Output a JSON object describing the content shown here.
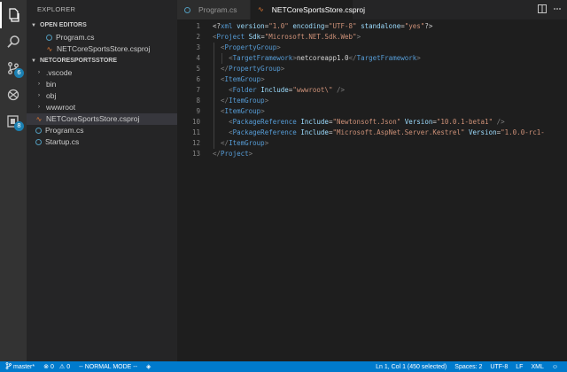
{
  "sidebar": {
    "title": "EXPLORER",
    "open_editors_label": "OPEN EDITORS",
    "open_editors": [
      {
        "name": "Program.cs",
        "icon": "csharp-icon"
      },
      {
        "name": "NETCoreSportsStore.csproj",
        "icon": "rss-icon"
      }
    ],
    "project_label": "NETCORESPORTSSTORE",
    "tree": [
      {
        "name": ".vscode",
        "type": "folder"
      },
      {
        "name": "bin",
        "type": "folder"
      },
      {
        "name": "obj",
        "type": "folder"
      },
      {
        "name": "wwwroot",
        "type": "folder"
      },
      {
        "name": "NETCoreSportsStore.csproj",
        "type": "file",
        "icon": "rss-icon"
      },
      {
        "name": "Program.cs",
        "type": "file",
        "icon": "csharp-icon"
      },
      {
        "name": "Startup.cs",
        "type": "file",
        "icon": "csharp-icon"
      }
    ]
  },
  "activity": {
    "scm_badge": "6",
    "extensions_badge": "8"
  },
  "tabs": [
    {
      "label": "Program.cs",
      "active": false
    },
    {
      "label": "NETCoreSportsStore.csproj",
      "active": true
    }
  ],
  "editor": {
    "line_numbers": [
      "1",
      "2",
      "3",
      "4",
      "5",
      "6",
      "7",
      "8",
      "9",
      "10",
      "11",
      "12",
      "13"
    ],
    "lines": [
      [
        [
          "pi",
          "<?"
        ],
        [
          "tag",
          "xml"
        ],
        [
          "pi",
          " "
        ],
        [
          "attr",
          "version"
        ],
        [
          "pi",
          "="
        ],
        [
          "val",
          "\"1.0\""
        ],
        [
          "pi",
          " "
        ],
        [
          "attr",
          "encoding"
        ],
        [
          "pi",
          "="
        ],
        [
          "val",
          "\"UTF-8\""
        ],
        [
          "pi",
          " "
        ],
        [
          "attr",
          "standalone"
        ],
        [
          "pi",
          "="
        ],
        [
          "val",
          "\"yes\""
        ],
        [
          "pi",
          "?>"
        ]
      ],
      [
        [
          "punct",
          "<"
        ],
        [
          "tag",
          "Project"
        ],
        [
          "text",
          " "
        ],
        [
          "attr",
          "Sdk"
        ],
        [
          "text",
          "="
        ],
        [
          "val",
          "\"Microsoft.NET.Sdk.Web\""
        ],
        [
          "punct",
          ">"
        ]
      ],
      [
        [
          "text",
          "  "
        ],
        [
          "punct",
          "<"
        ],
        [
          "tag",
          "PropertyGroup"
        ],
        [
          "punct",
          ">"
        ]
      ],
      [
        [
          "text",
          "    "
        ],
        [
          "punct",
          "<"
        ],
        [
          "tag",
          "TargetFramework"
        ],
        [
          "punct",
          ">"
        ],
        [
          "text",
          "netcoreapp1.0"
        ],
        [
          "punct",
          "</"
        ],
        [
          "tag",
          "TargetFramework"
        ],
        [
          "punct",
          ">"
        ]
      ],
      [
        [
          "text",
          "  "
        ],
        [
          "punct",
          "</"
        ],
        [
          "tag",
          "PropertyGroup"
        ],
        [
          "punct",
          ">"
        ]
      ],
      [
        [
          "text",
          "  "
        ],
        [
          "punct",
          "<"
        ],
        [
          "tag",
          "ItemGroup"
        ],
        [
          "punct",
          ">"
        ]
      ],
      [
        [
          "text",
          "    "
        ],
        [
          "punct",
          "<"
        ],
        [
          "tag",
          "Folder"
        ],
        [
          "text",
          " "
        ],
        [
          "attr",
          "Include"
        ],
        [
          "text",
          "="
        ],
        [
          "val",
          "\"wwwroot\\\""
        ],
        [
          "text",
          " "
        ],
        [
          "punct",
          "/>"
        ]
      ],
      [
        [
          "text",
          "  "
        ],
        [
          "punct",
          "</"
        ],
        [
          "tag",
          "ItemGroup"
        ],
        [
          "punct",
          ">"
        ]
      ],
      [
        [
          "text",
          "  "
        ],
        [
          "punct",
          "<"
        ],
        [
          "tag",
          "ItemGroup"
        ],
        [
          "punct",
          ">"
        ]
      ],
      [
        [
          "text",
          "    "
        ],
        [
          "punct",
          "<"
        ],
        [
          "tag",
          "PackageReference"
        ],
        [
          "text",
          " "
        ],
        [
          "attr",
          "Include"
        ],
        [
          "text",
          "="
        ],
        [
          "val",
          "\"Newtonsoft.Json\""
        ],
        [
          "text",
          " "
        ],
        [
          "attr",
          "Version"
        ],
        [
          "text",
          "="
        ],
        [
          "val",
          "\"10.0.1-beta1\""
        ],
        [
          "text",
          " "
        ],
        [
          "punct",
          "/>"
        ]
      ],
      [
        [
          "text",
          "    "
        ],
        [
          "punct",
          "<"
        ],
        [
          "tag",
          "PackageReference"
        ],
        [
          "text",
          " "
        ],
        [
          "attr",
          "Include"
        ],
        [
          "text",
          "="
        ],
        [
          "val",
          "\"Microsoft.AspNet.Server.Kestrel\""
        ],
        [
          "text",
          " "
        ],
        [
          "attr",
          "Version"
        ],
        [
          "text",
          "="
        ],
        [
          "val",
          "\"1.0.0-rc1-"
        ]
      ],
      [
        [
          "text",
          "  "
        ],
        [
          "punct",
          "</"
        ],
        [
          "tag",
          "ItemGroup"
        ],
        [
          "punct",
          ">"
        ]
      ],
      [
        [
          "punct",
          "</"
        ],
        [
          "tag",
          "Project"
        ],
        [
          "punct",
          ">"
        ]
      ]
    ]
  },
  "status": {
    "branch": "master*",
    "errors": "0",
    "warnings": "0",
    "mode": "-- NORMAL MODE --",
    "position": "Ln 1, Col 1 (450 selected)",
    "spaces": "Spaces: 2",
    "encoding": "UTF-8",
    "eol": "LF",
    "language": "XML"
  },
  "colors": {
    "accent": "#007acc",
    "activity_bg": "#333333",
    "sidebar_bg": "#252526",
    "editor_bg": "#1e1e1e"
  }
}
